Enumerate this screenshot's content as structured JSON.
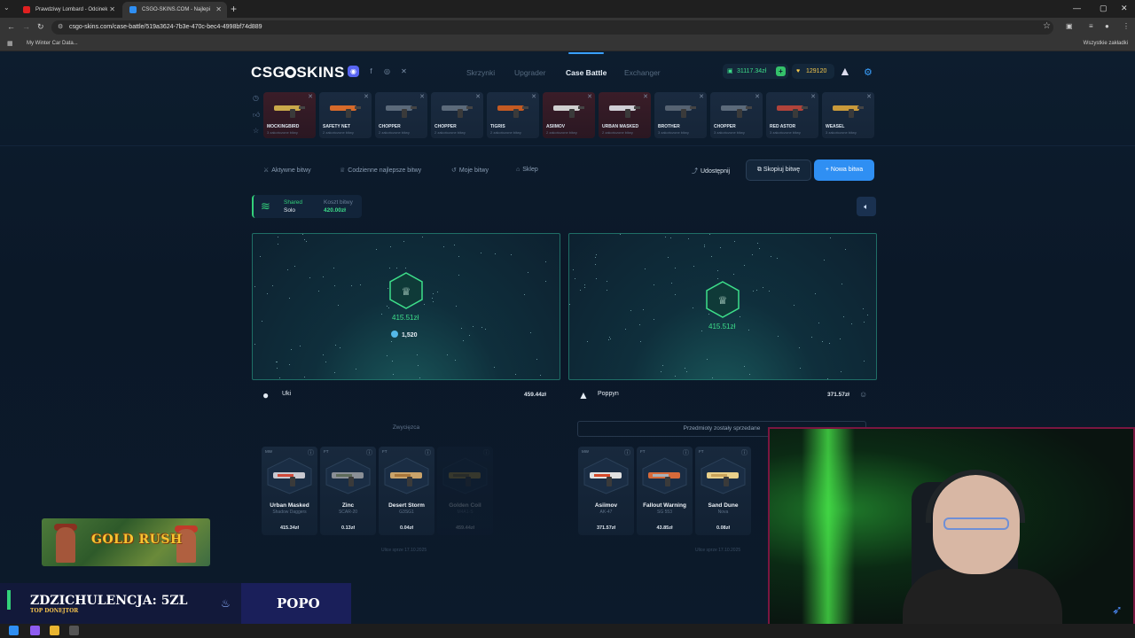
{
  "browser": {
    "tabs": [
      {
        "title": "Prawdziwy Lombard - Odcinek"
      },
      {
        "title": "CSGO-SKINS.COM - Najlepi"
      }
    ],
    "url": "csgo-skins.com/case-battle/519a3624-7b3e-470c-bec4-4998bf74d889",
    "bookmark": "My Winter Car Data...",
    "bookmarks_right": "Wszystkie zakładki"
  },
  "header": {
    "logo": "CSG SKINS",
    "nav": [
      "Skrzynki",
      "Upgrader",
      "Case Battle",
      "Exchanger"
    ],
    "active_nav": "Case Battle",
    "balance": "31117.34zł",
    "coins": "129120",
    "accent": "#3aa0ff"
  },
  "drops": [
    {
      "name": "MOCKINGBIRD",
      "sub": "3 zakończone bitwy",
      "color": "red"
    },
    {
      "name": "SAFETY NET",
      "sub": "2 zakończone bitwy",
      "color": "blue"
    },
    {
      "name": "CHOPPER",
      "sub": "2 zakończone bitwy",
      "color": "blue"
    },
    {
      "name": "CHOPPER",
      "sub": "2 zakończone bitwy",
      "color": "blue"
    },
    {
      "name": "TIGRIS",
      "sub": "2 zakończone bitwy",
      "color": "blue"
    },
    {
      "name": "ASIIMOV",
      "sub": "2 zakończone bitwy",
      "color": "red"
    },
    {
      "name": "URBAN MASKED",
      "sub": "2 zakończone bitwy",
      "color": "red"
    },
    {
      "name": "BROTHER",
      "sub": "3 zakończone bitwy",
      "color": "blue"
    },
    {
      "name": "CHOPPER",
      "sub": "3 zakończone bitwy",
      "color": "blue"
    },
    {
      "name": "RED ASTOR",
      "sub": "3 zakończone bitwy",
      "color": "blue"
    },
    {
      "name": "WEASEL",
      "sub": "3 zakończone bitwy",
      "color": "blue"
    }
  ],
  "toolbar": {
    "active": "Aktywne bitwy",
    "daily": "Codzienne najlepsze bitwy",
    "mine": "Moje bitwy",
    "shop": "Sklep",
    "share": "Udostępnij",
    "copy": "Skopiuj bitwę",
    "new": "+ Nowa bitwa"
  },
  "mode": {
    "type": "Shared",
    "sub": "Solo",
    "cost_label": "Koszt bitwy",
    "cost": "420.00zł"
  },
  "players": [
    {
      "name": "Uki",
      "total": "459.44zł",
      "win": "415.51zł",
      "coins": "1,520",
      "status": "Zwycięzca",
      "items": [
        {
          "q": "MW",
          "name": "Urban Masked",
          "sub": "Shadow Daggers",
          "price": "415.34zł"
        },
        {
          "q": "FT",
          "name": "Zinc",
          "sub": "SCAR-20",
          "price": "0.13zł"
        },
        {
          "q": "FT",
          "name": "Desert Storm",
          "sub": "G3SG1",
          "price": "0.04zł"
        },
        {
          "q": "",
          "name": "Golden Coil",
          "sub": "M4A1-S",
          "price": "459.44zł"
        }
      ],
      "footer": "Ulice sprze 17.10.2025"
    },
    {
      "name": "Poppyn",
      "total": "371.57zł",
      "win": "415.51zł",
      "status": "Przedmioty zostały sprzedane",
      "items": [
        {
          "q": "MW",
          "name": "Asiimov",
          "sub": "AK-47",
          "price": "371.57zł"
        },
        {
          "q": "FT",
          "name": "Fallout Warning",
          "sub": "SG 553",
          "price": "43.85zł"
        },
        {
          "q": "FT",
          "name": "Sand Dune",
          "sub": "Nova",
          "price": "0.08zł"
        }
      ],
      "footer": "Ulice sprze 17.10.2025"
    }
  ],
  "overlay": {
    "game": "GOLD RUSH",
    "donor_label": "ZDZICHULENCJA: 5ZL",
    "donor_tag": "TOP DONEJTOR",
    "donor_right": "POPO"
  }
}
